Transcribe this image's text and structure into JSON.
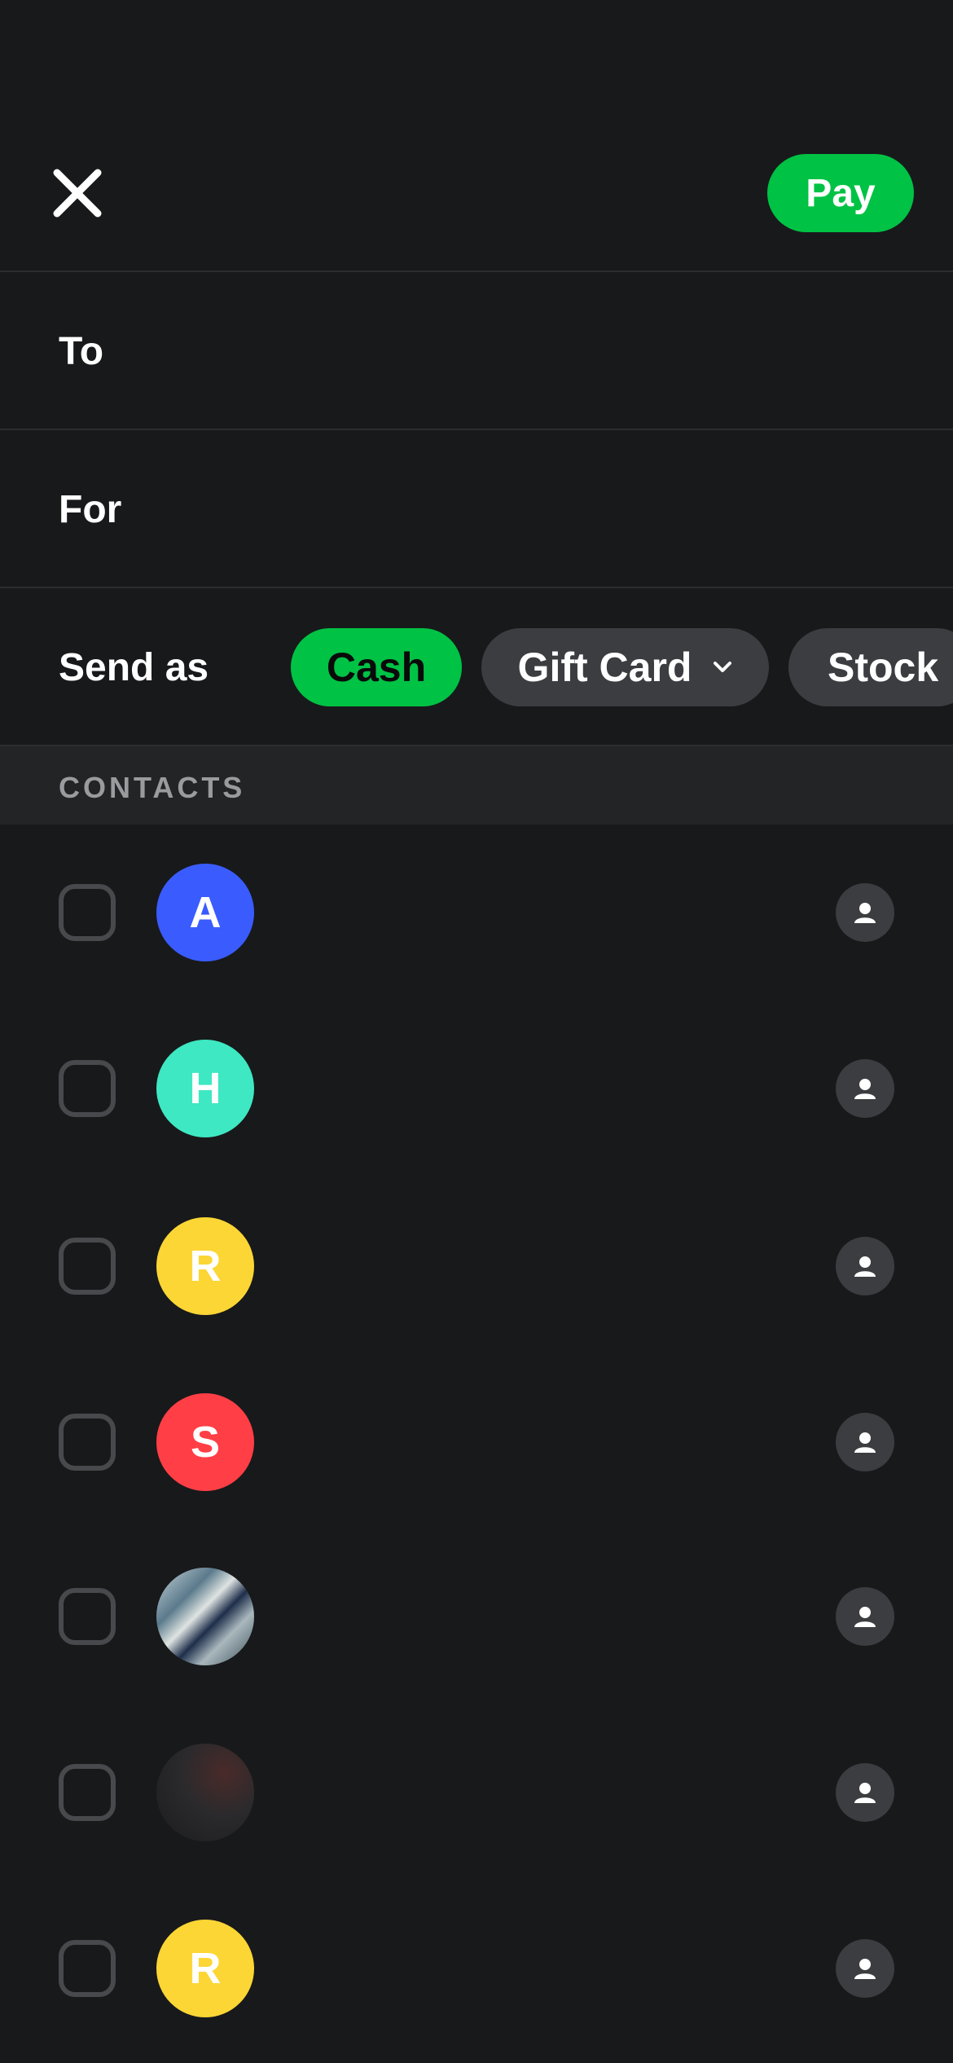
{
  "header": {
    "close_icon": "close-icon",
    "pay_label": "Pay",
    "accent": "#00c244"
  },
  "fields": {
    "to_label": "To",
    "for_label": "For",
    "send_as_label": "Send as"
  },
  "send_as_options": [
    {
      "label": "Cash",
      "selected": true
    },
    {
      "label": "Gift Card",
      "selected": false,
      "icon": "chevron-down-icon"
    },
    {
      "label": "Stock",
      "selected": false
    }
  ],
  "contacts": {
    "header": "CONTACTS",
    "items": [
      {
        "initial": "A",
        "color": "#3a5cff"
      },
      {
        "initial": "H",
        "color": "#3ee8c2"
      },
      {
        "initial": "R",
        "color": "#fbd635"
      },
      {
        "initial": "S",
        "color": "#ff3f45"
      },
      {
        "initial": "",
        "photo": "sky-photo"
      },
      {
        "initial": "",
        "photo": "dark-pattern-photo"
      },
      {
        "initial": "R",
        "color": "#fbd635"
      }
    ]
  }
}
